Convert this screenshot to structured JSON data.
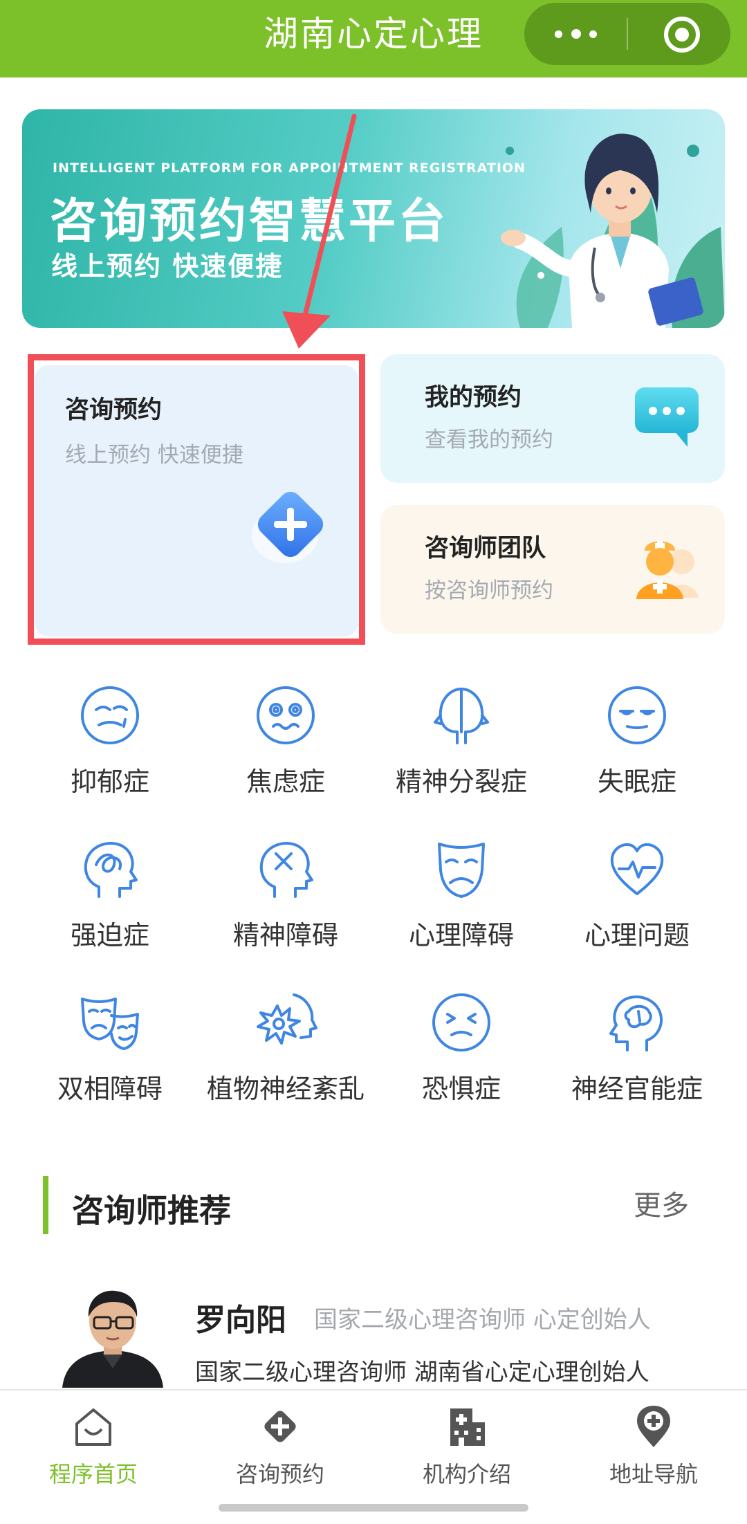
{
  "header": {
    "title": "湖南心定心理"
  },
  "banner": {
    "en_title": "INTELLIGENT PLATFORM FOR APPOINTMENT REGISTRATION",
    "title": "咨询预约智慧平台",
    "subtitle": "线上预约 快速便捷"
  },
  "cards": {
    "main": {
      "title": "咨询预约",
      "subtitle": "线上预约 快速便捷"
    },
    "my": {
      "title": "我的预约",
      "subtitle": "查看我的预约"
    },
    "team": {
      "title": "咨询师团队",
      "subtitle": "按咨询师预约"
    }
  },
  "categories": [
    {
      "label": "抑郁症",
      "icon": "sad-face-icon"
    },
    {
      "label": "焦虑症",
      "icon": "dizzy-face-icon"
    },
    {
      "label": "精神分裂症",
      "icon": "two-heads-icon"
    },
    {
      "label": "失眠症",
      "icon": "sleepy-face-icon"
    },
    {
      "label": "强迫症",
      "icon": "tangled-head-icon"
    },
    {
      "label": "精神障碍",
      "icon": "crossed-head-icon"
    },
    {
      "label": "心理障碍",
      "icon": "mask-icon"
    },
    {
      "label": "心理问题",
      "icon": "heart-pulse-icon"
    },
    {
      "label": "双相障碍",
      "icon": "theater-masks-icon"
    },
    {
      "label": "植物神经紊乱",
      "icon": "burst-head-icon"
    },
    {
      "label": "恐惧症",
      "icon": "scared-face-icon"
    },
    {
      "label": "神经官能症",
      "icon": "brain-head-icon"
    }
  ],
  "recommend": {
    "title": "咨询师推荐",
    "more": "更多",
    "counselor": {
      "name": "罗向阳",
      "title": "国家二级心理咨询师 心定创始人",
      "desc": "国家二级心理咨询师 湖南省心定心理创始人"
    }
  },
  "tabbar": [
    {
      "label": "程序首页",
      "icon": "home-icon",
      "active": true
    },
    {
      "label": "咨询预约",
      "icon": "plus-diamond-icon",
      "active": false
    },
    {
      "label": "机构介绍",
      "icon": "building-icon",
      "active": false
    },
    {
      "label": "地址导航",
      "icon": "location-pin-icon",
      "active": false
    }
  ],
  "colors": {
    "brand": "#7dc12a",
    "icon_blue": "#3f86e3",
    "highlight": "#f14f57"
  }
}
